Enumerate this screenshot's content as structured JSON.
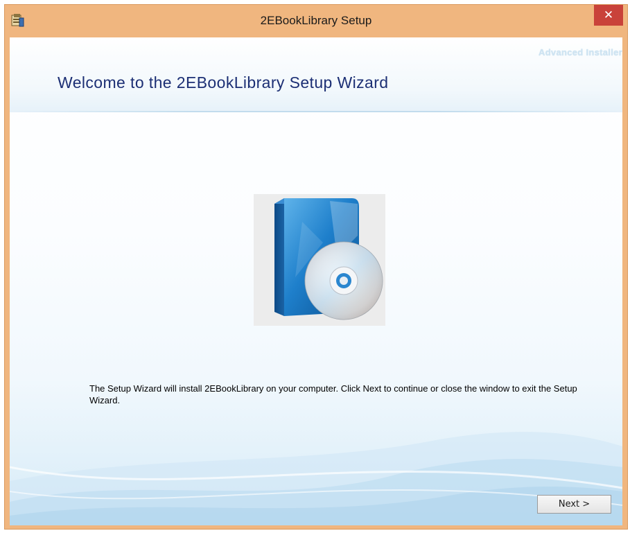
{
  "window": {
    "title": "2EBookLibrary Setup",
    "close_label": "✕"
  },
  "header": {
    "brand": "Advanced Installer",
    "title": "Welcome to the 2EBookLibrary Setup Wizard"
  },
  "body": {
    "description": "The Setup Wizard will install 2EBookLibrary on your computer. Click Next to continue or close the window to exit the Setup Wizard.",
    "product_icon": "software-box-with-cd-icon"
  },
  "footer": {
    "next_label": "Next >"
  },
  "colors": {
    "frame": "#f0b67f",
    "close_button": "#c9423a",
    "title_text": "#1c2f74",
    "box_blue": "#1e6fb4"
  }
}
